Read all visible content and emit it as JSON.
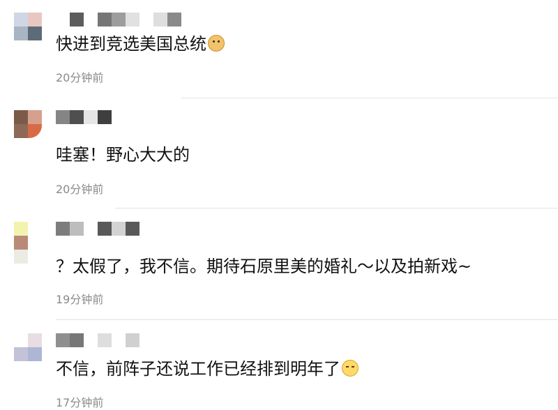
{
  "comments": [
    {
      "text": "快进到竞选美国总统",
      "emoji": "doge-icon",
      "time": "20分钟前"
    },
    {
      "text": "哇塞！野心大大的",
      "emoji": "",
      "time": "20分钟前"
    },
    {
      "text": "？太假了，我不信。期待石原里美的婚礼～以及拍新戏~",
      "emoji": "",
      "time": "19分钟前"
    },
    {
      "text": "不信，前阵子还说工作已经排到明年了",
      "emoji": "shy-face-icon",
      "time": "17分钟前"
    }
  ],
  "colors": {
    "text": "#111111",
    "timestamp": "#8a8a8a",
    "divider": "#e3e3e3"
  }
}
